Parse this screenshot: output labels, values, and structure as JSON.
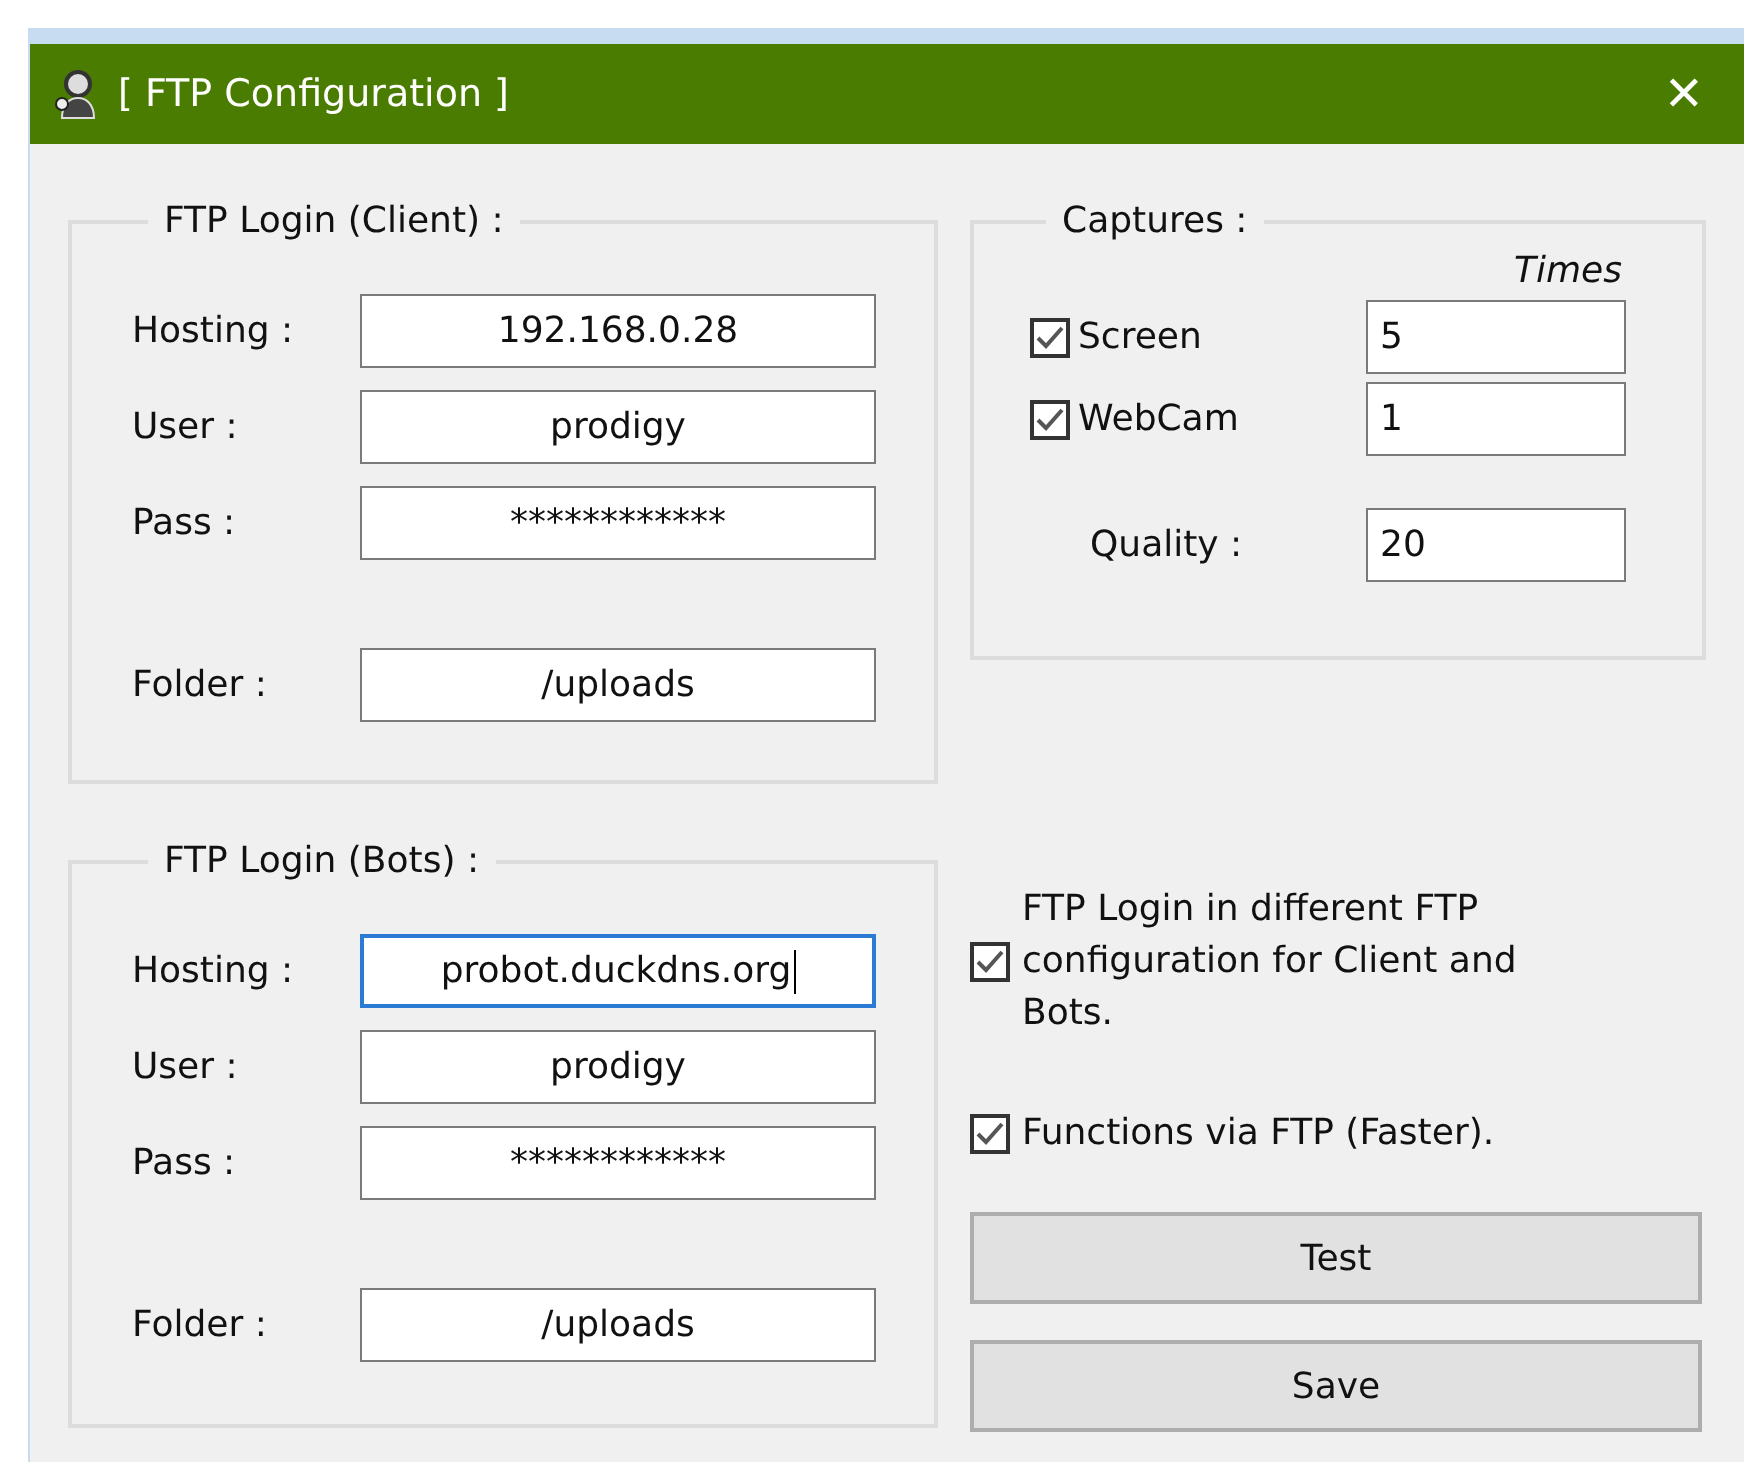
{
  "window": {
    "title": "[ FTP Configuration ]",
    "close": "✕"
  },
  "groups": [
    {
      "title": "FTP Login (Client) :",
      "fields": [
        {
          "label": "Hosting :",
          "value": "192.168.0.28",
          "focused": false
        },
        {
          "label": "User :",
          "value": "prodigy",
          "focused": false
        },
        {
          "label": "Pass :",
          "value": "************",
          "focused": false
        },
        {
          "label": "Folder :",
          "value": "/uploads",
          "focused": false
        }
      ]
    },
    {
      "title": "FTP Login (Bots) :",
      "fields": [
        {
          "label": "Hosting :",
          "value": "probot.duckdns.org",
          "focused": true
        },
        {
          "label": "User :",
          "value": "prodigy",
          "focused": false
        },
        {
          "label": "Pass :",
          "value": "************",
          "focused": false
        },
        {
          "label": "Folder :",
          "value": "/uploads",
          "focused": false
        }
      ]
    }
  ],
  "captures": {
    "title": "Captures :",
    "column_header": "Times",
    "items": [
      {
        "label": "Screen",
        "checked": true,
        "value": "5"
      },
      {
        "label": "WebCam",
        "checked": true,
        "value": "1"
      }
    ],
    "quality": {
      "label": "Quality :",
      "value": "20"
    }
  },
  "options": [
    {
      "label": "FTP Login in different FTP configuration for Client and Bots.",
      "checked": true
    },
    {
      "label": "Functions via FTP (Faster).",
      "checked": true
    }
  ],
  "buttons": [
    "Test",
    "Save"
  ]
}
